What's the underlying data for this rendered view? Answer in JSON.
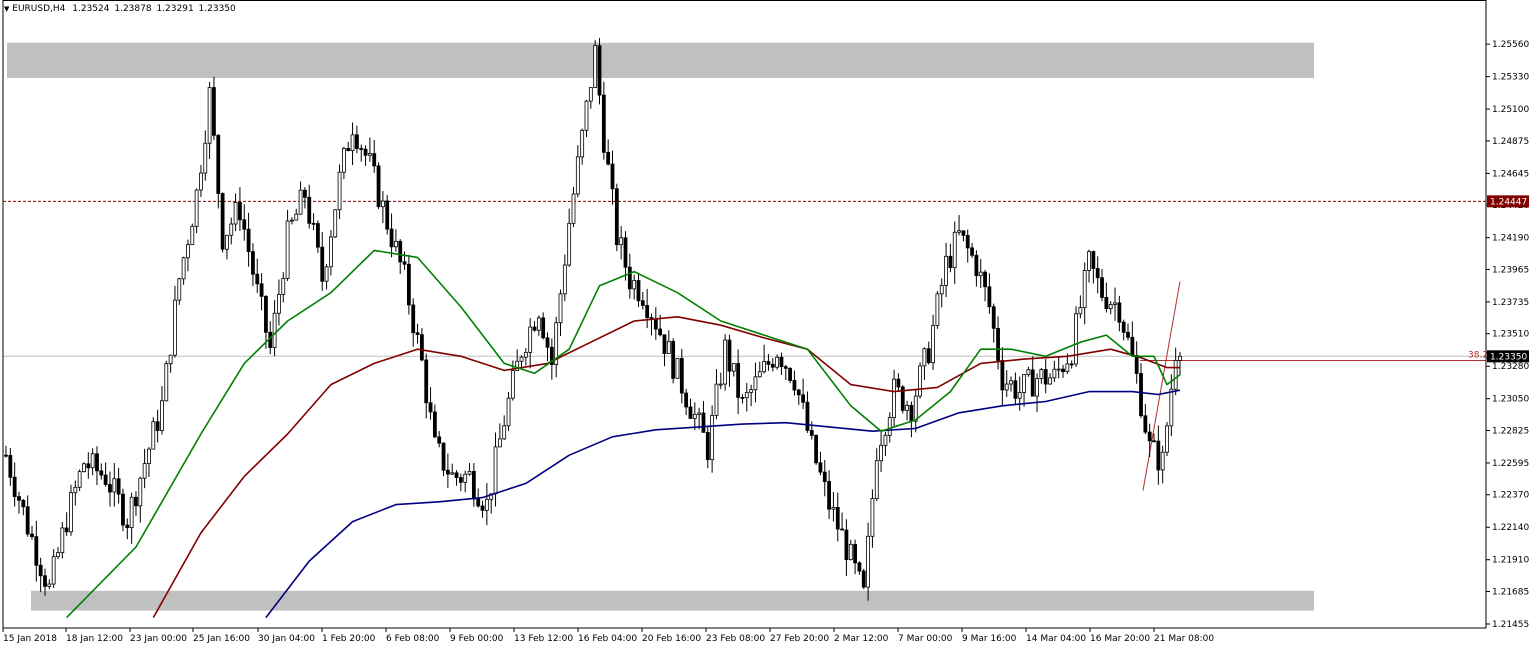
{
  "header": {
    "symbol": "EURUSD,H4",
    "open": "1.23524",
    "high": "1.23878",
    "low": "1.23291",
    "close": "1.23350"
  },
  "colors": {
    "background": "#ffffff",
    "candle": "#000000",
    "zone": "#c0c0c0",
    "ma_fast": "#008000",
    "ma_mid": "#800000",
    "ma_slow": "#000080",
    "resistance_line": "#800000",
    "current_price_line": "#c0c0c0",
    "fib_line": "#b03030",
    "price_label_bg_red": "#800000",
    "price_label_bg_black": "#000000"
  },
  "chart_data": {
    "type": "candlestick",
    "instrument": "EURUSD",
    "timeframe": "H4",
    "ylim": [
      1.21455,
      1.2566
    ],
    "y_ticks": [
      "1.25560",
      "1.25330",
      "1.25100",
      "1.24875",
      "1.24645",
      "1.24420",
      "1.24190",
      "1.23965",
      "1.23735",
      "1.23510",
      "1.23280",
      "1.23050",
      "1.22825",
      "1.22595",
      "1.22370",
      "1.22140",
      "1.21910",
      "1.21685",
      "1.21455"
    ],
    "x_ticks": [
      "15 Jan 2018",
      "18 Jan 12:00",
      "23 Jan 00:00",
      "25 Jan 16:00",
      "30 Jan 04:00",
      "1 Feb 20:00",
      "6 Feb 08:00",
      "9 Feb 00:00",
      "13 Feb 12:00",
      "16 Feb 04:00",
      "20 Feb 16:00",
      "23 Feb 08:00",
      "27 Feb 20:00",
      "2 Mar 12:00",
      "7 Mar 00:00",
      "9 Mar 16:00",
      "14 Mar 04:00",
      "16 Mar 20:00",
      "21 Mar 08:00"
    ],
    "current_price": "1.23350",
    "resistance_level": "1.24447",
    "fib_label": "38.2",
    "fib_level": 1.2332,
    "zones": [
      {
        "from": 1.2532,
        "to": 1.2557
      },
      {
        "from": 1.2155,
        "to": 1.2169
      }
    ],
    "x_range_index": [
      0,
      271
    ],
    "anchors": [
      {
        "i": 0,
        "p": 1.2265
      },
      {
        "i": 5,
        "p": 1.2215
      },
      {
        "i": 10,
        "p": 1.217
      },
      {
        "i": 14,
        "p": 1.222
      },
      {
        "i": 18,
        "p": 1.226
      },
      {
        "i": 23,
        "p": 1.225
      },
      {
        "i": 28,
        "p": 1.222
      },
      {
        "i": 32,
        "p": 1.226
      },
      {
        "i": 36,
        "p": 1.23
      },
      {
        "i": 40,
        "p": 1.239
      },
      {
        "i": 44,
        "p": 1.245
      },
      {
        "i": 47,
        "p": 1.252
      },
      {
        "i": 50,
        "p": 1.242
      },
      {
        "i": 54,
        "p": 1.244
      },
      {
        "i": 58,
        "p": 1.238
      },
      {
        "i": 61,
        "p": 1.234
      },
      {
        "i": 65,
        "p": 1.242
      },
      {
        "i": 69,
        "p": 1.245
      },
      {
        "i": 73,
        "p": 1.239
      },
      {
        "i": 77,
        "p": 1.246
      },
      {
        "i": 80,
        "p": 1.25
      },
      {
        "i": 84,
        "p": 1.247
      },
      {
        "i": 88,
        "p": 1.243
      },
      {
        "i": 92,
        "p": 1.239
      },
      {
        "i": 96,
        "p": 1.233
      },
      {
        "i": 99,
        "p": 1.227
      },
      {
        "i": 103,
        "p": 1.225
      },
      {
        "i": 107,
        "p": 1.225
      },
      {
        "i": 111,
        "p": 1.223
      },
      {
        "i": 115,
        "p": 1.229
      },
      {
        "i": 119,
        "p": 1.234
      },
      {
        "i": 123,
        "p": 1.237
      },
      {
        "i": 126,
        "p": 1.233
      },
      {
        "i": 130,
        "p": 1.243
      },
      {
        "i": 133,
        "p": 1.249
      },
      {
        "i": 136,
        "p": 1.255
      },
      {
        "i": 138,
        "p": 1.249
      },
      {
        "i": 141,
        "p": 1.242
      },
      {
        "i": 144,
        "p": 1.239
      },
      {
        "i": 147,
        "p": 1.238
      },
      {
        "i": 150,
        "p": 1.236
      },
      {
        "i": 154,
        "p": 1.233
      },
      {
        "i": 158,
        "p": 1.23
      },
      {
        "i": 162,
        "p": 1.227
      },
      {
        "i": 166,
        "p": 1.234
      },
      {
        "i": 170,
        "p": 1.23
      },
      {
        "i": 174,
        "p": 1.232
      },
      {
        "i": 178,
        "p": 1.234
      },
      {
        "i": 182,
        "p": 1.232
      },
      {
        "i": 186,
        "p": 1.227
      },
      {
        "i": 190,
        "p": 1.223
      },
      {
        "i": 194,
        "p": 1.22
      },
      {
        "i": 198,
        "p": 1.2165
      },
      {
        "i": 201,
        "p": 1.227
      },
      {
        "i": 205,
        "p": 1.231
      },
      {
        "i": 209,
        "p": 1.23
      },
      {
        "i": 213,
        "p": 1.234
      },
      {
        "i": 217,
        "p": 1.24
      },
      {
        "i": 220,
        "p": 1.242
      },
      {
        "i": 224,
        "p": 1.24
      },
      {
        "i": 227,
        "p": 1.237
      },
      {
        "i": 230,
        "p": 1.232
      },
      {
        "i": 234,
        "p": 1.231
      },
      {
        "i": 238,
        "p": 1.232
      },
      {
        "i": 242,
        "p": 1.232
      },
      {
        "i": 246,
        "p": 1.234
      },
      {
        "i": 250,
        "p": 1.24
      },
      {
        "i": 253,
        "p": 1.238
      },
      {
        "i": 257,
        "p": 1.237
      },
      {
        "i": 261,
        "p": 1.232
      },
      {
        "i": 264,
        "p": 1.227
      },
      {
        "i": 267,
        "p": 1.226
      },
      {
        "i": 270,
        "p": 1.234
      },
      {
        "i": 271,
        "p": 1.2356
      }
    ],
    "ma_fast": [
      {
        "i": 14,
        "p": 1.215
      },
      {
        "i": 30,
        "p": 1.22
      },
      {
        "i": 45,
        "p": 1.228
      },
      {
        "i": 55,
        "p": 1.233
      },
      {
        "i": 65,
        "p": 1.236
      },
      {
        "i": 75,
        "p": 1.238
      },
      {
        "i": 85,
        "p": 1.241
      },
      {
        "i": 95,
        "p": 1.2405
      },
      {
        "i": 105,
        "p": 1.237
      },
      {
        "i": 115,
        "p": 1.233
      },
      {
        "i": 122,
        "p": 1.2323
      },
      {
        "i": 130,
        "p": 1.234
      },
      {
        "i": 137,
        "p": 1.2385
      },
      {
        "i": 145,
        "p": 1.2395
      },
      {
        "i": 155,
        "p": 1.238
      },
      {
        "i": 165,
        "p": 1.236
      },
      {
        "i": 175,
        "p": 1.235
      },
      {
        "i": 185,
        "p": 1.234
      },
      {
        "i": 195,
        "p": 1.23
      },
      {
        "i": 202,
        "p": 1.2282
      },
      {
        "i": 210,
        "p": 1.229
      },
      {
        "i": 218,
        "p": 1.231
      },
      {
        "i": 225,
        "p": 1.234
      },
      {
        "i": 232,
        "p": 1.234
      },
      {
        "i": 240,
        "p": 1.2335
      },
      {
        "i": 248,
        "p": 1.2345
      },
      {
        "i": 254,
        "p": 1.235
      },
      {
        "i": 260,
        "p": 1.2335
      },
      {
        "i": 265,
        "p": 1.2335
      },
      {
        "i": 268,
        "p": 1.2315
      },
      {
        "i": 271,
        "p": 1.2322
      }
    ],
    "ma_mid": [
      {
        "i": 34,
        "p": 1.215
      },
      {
        "i": 45,
        "p": 1.221
      },
      {
        "i": 55,
        "p": 1.225
      },
      {
        "i": 65,
        "p": 1.228
      },
      {
        "i": 75,
        "p": 1.2315
      },
      {
        "i": 85,
        "p": 1.233
      },
      {
        "i": 95,
        "p": 1.234
      },
      {
        "i": 105,
        "p": 1.2335
      },
      {
        "i": 115,
        "p": 1.2325
      },
      {
        "i": 125,
        "p": 1.233
      },
      {
        "i": 135,
        "p": 1.2345
      },
      {
        "i": 145,
        "p": 1.236
      },
      {
        "i": 155,
        "p": 1.2363
      },
      {
        "i": 165,
        "p": 1.2357
      },
      {
        "i": 175,
        "p": 1.2348
      },
      {
        "i": 185,
        "p": 1.234
      },
      {
        "i": 195,
        "p": 1.2315
      },
      {
        "i": 205,
        "p": 1.231
      },
      {
        "i": 215,
        "p": 1.2313
      },
      {
        "i": 225,
        "p": 1.233
      },
      {
        "i": 235,
        "p": 1.2333
      },
      {
        "i": 245,
        "p": 1.2335
      },
      {
        "i": 255,
        "p": 1.234
      },
      {
        "i": 262,
        "p": 1.2334
      },
      {
        "i": 268,
        "p": 1.2327
      },
      {
        "i": 271,
        "p": 1.2327
      }
    ],
    "ma_slow": [
      {
        "i": 60,
        "p": 1.215
      },
      {
        "i": 70,
        "p": 1.219
      },
      {
        "i": 80,
        "p": 1.2218
      },
      {
        "i": 90,
        "p": 1.223
      },
      {
        "i": 100,
        "p": 1.2232
      },
      {
        "i": 110,
        "p": 1.2235
      },
      {
        "i": 120,
        "p": 1.2245
      },
      {
        "i": 130,
        "p": 1.2265
      },
      {
        "i": 140,
        "p": 1.2278
      },
      {
        "i": 150,
        "p": 1.2283
      },
      {
        "i": 160,
        "p": 1.2285
      },
      {
        "i": 170,
        "p": 1.2287
      },
      {
        "i": 180,
        "p": 1.2288
      },
      {
        "i": 190,
        "p": 1.2285
      },
      {
        "i": 200,
        "p": 1.2282
      },
      {
        "i": 210,
        "p": 1.2284
      },
      {
        "i": 220,
        "p": 1.2295
      },
      {
        "i": 230,
        "p": 1.23
      },
      {
        "i": 240,
        "p": 1.2303
      },
      {
        "i": 250,
        "p": 1.231
      },
      {
        "i": 260,
        "p": 1.231
      },
      {
        "i": 266,
        "p": 1.2308
      },
      {
        "i": 271,
        "p": 1.2311
      }
    ]
  }
}
